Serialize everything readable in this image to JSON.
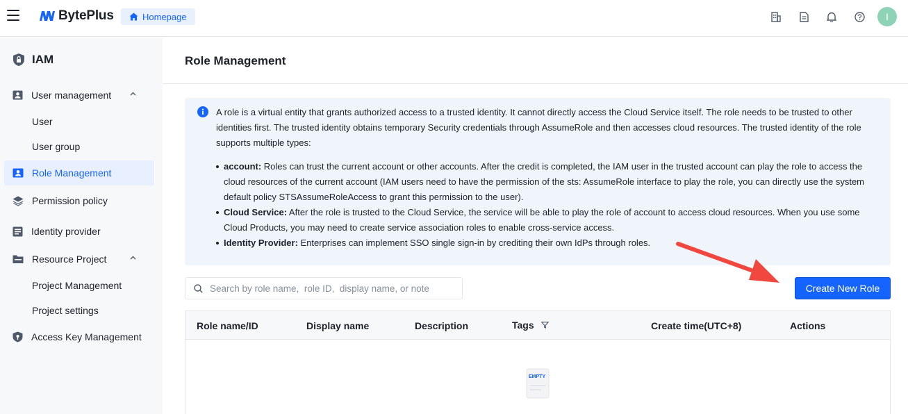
{
  "topbar": {
    "brand": "BytePlus",
    "homepage_label": "Homepage",
    "avatar_initial": "I",
    "brand_color": "#1664ff"
  },
  "sidebar": {
    "title": "IAM",
    "items": [
      {
        "label": "User management",
        "icon": "user-card-icon",
        "expanded": true
      },
      {
        "label": "User"
      },
      {
        "label": "User group"
      },
      {
        "label": "Role Management",
        "icon": "role-icon",
        "active": true
      },
      {
        "label": "Permission policy",
        "icon": "layers-icon"
      },
      {
        "label": "Identity provider",
        "icon": "id-card-icon"
      },
      {
        "label": "Resource Project",
        "icon": "folder-icon",
        "expanded": true
      },
      {
        "label": "Project Management"
      },
      {
        "label": "Project settings"
      },
      {
        "label": "Access Key Management",
        "icon": "shield-key-icon"
      }
    ]
  },
  "main": {
    "title": "Role Management",
    "info": {
      "intro": "A role is a virtual entity that grants authorized access to a trusted identity. It cannot directly access the Cloud Service itself. The role needs to be trusted to other identities first. The trusted identity obtains temporary Security credentials through AssumeRole and then accesses cloud resources. The trusted identity of the role supports multiple types:",
      "bullets": [
        {
          "term": "account:",
          "text": " Roles can trust the current account or other accounts. After the credit is completed, the IAM user in the trusted account can play the role to access the cloud resources of the current account (IAM users need to have the permission of the sts: AssumeRole interface to play the role, you can directly use the system default policy STSAssumeRoleAccess to grant this permission to the user)."
        },
        {
          "term": "Cloud Service:",
          "text": " After the role is trusted to the Cloud Service, the service will be able to play the role of account to access cloud resources. When you use some Cloud Products, you may need to create service association roles to enable cross-service access."
        },
        {
          "term": "Identity Provider:",
          "text": " Enterprises can implement SSO single sign-in by crediting their own IdPs through roles."
        }
      ]
    },
    "search_placeholder": "Search by role name,  role ID,  display name, or note",
    "create_button": "Create New Role",
    "table": {
      "columns": [
        "Role name/ID",
        "Display name",
        "Description",
        "Tags",
        "Create time(UTC+8)",
        "Actions"
      ],
      "rows": [],
      "empty_icon_text": "EMPTY"
    }
  },
  "annotation_color": "#f0483e"
}
